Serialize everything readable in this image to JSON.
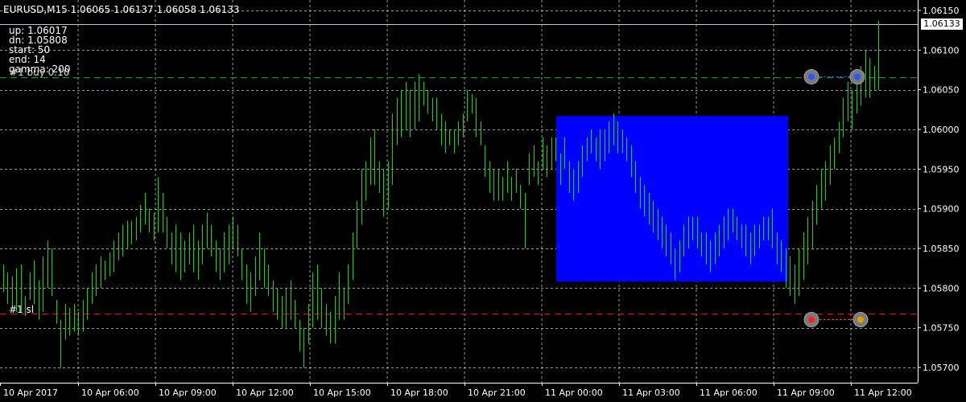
{
  "header": {
    "symbol_timeframe": "EURUSD,M15",
    "ohlc": "1.06065 1.06137 1.06058 1.06133"
  },
  "indicator": {
    "lines": [
      "up: 1.06017",
      "dn: 1.05808",
      "start: 50",
      "end: 14",
      "gamma: 200"
    ],
    "overlap_label": "#1 buy 0.10"
  },
  "trade_label": "#1 sl",
  "current_price_tag": "1.06133",
  "colors": {
    "background": "#000000",
    "grid": "#bfbfbf",
    "candle": "#00e000",
    "box": "#0000ff",
    "buy_line": "#00b000",
    "sl_line": "#ff0000",
    "bid_line": "#c8c8d4"
  },
  "chart_data": {
    "type": "candlestick",
    "symbol": "EURUSD",
    "timeframe": "M15",
    "ylim": [
      1.0568,
      1.0617
    ],
    "y_ticks": [
      "1.06150",
      "1.06100",
      "1.06050",
      "1.06000",
      "1.05950",
      "1.05900",
      "1.05850",
      "1.05800",
      "1.05750",
      "1.05700"
    ],
    "x_ticks": [
      "10 Apr 2017",
      "10 Apr 06:00",
      "10 Apr 09:00",
      "10 Apr 12:00",
      "10 Apr 15:00",
      "10 Apr 18:00",
      "10 Apr 21:00",
      "11 Apr 00:00",
      "11 Apr 03:00",
      "11 Apr 06:00",
      "11 Apr 09:00",
      "11 Apr 12:00"
    ],
    "box": {
      "up": 1.06017,
      "dn": 1.05808,
      "from": "11 Apr 00:00",
      "to": "11 Apr 09:00"
    },
    "levels": {
      "buy": 1.06066,
      "stop_loss": 1.05768,
      "bid": 1.06133
    },
    "bar_ranges": [
      [
        1.05795,
        1.0583
      ],
      [
        1.0578,
        1.0582
      ],
      [
        1.05775,
        1.05815
      ],
      [
        1.0577,
        1.05825
      ],
      [
        1.0577,
        1.0583
      ],
      [
        1.05765,
        1.0579
      ],
      [
        1.05785,
        1.0582
      ],
      [
        1.0578,
        1.05835
      ],
      [
        1.0576,
        1.0581
      ],
      [
        1.0577,
        1.0584
      ],
      [
        1.058,
        1.0586
      ],
      [
        1.0579,
        1.0585
      ],
      [
        1.05755,
        1.05785
      ],
      [
        1.057,
        1.0576
      ],
      [
        1.05735,
        1.0578
      ],
      [
        1.0574,
        1.05775
      ],
      [
        1.05745,
        1.0578
      ],
      [
        1.0574,
        1.0577
      ],
      [
        1.05745,
        1.05785
      ],
      [
        1.0576,
        1.058
      ],
      [
        1.0578,
        1.0582
      ],
      [
        1.0579,
        1.0583
      ],
      [
        1.058,
        1.0584
      ],
      [
        1.0581,
        1.05835
      ],
      [
        1.05815,
        1.05845
      ],
      [
        1.0582,
        1.0586
      ],
      [
        1.05835,
        1.0587
      ],
      [
        1.0584,
        1.0588
      ],
      [
        1.0585,
        1.05885
      ],
      [
        1.05855,
        1.05885
      ],
      [
        1.0586,
        1.0589
      ],
      [
        1.0587,
        1.05905
      ],
      [
        1.0588,
        1.0592
      ],
      [
        1.0587,
        1.059
      ],
      [
        1.0586,
        1.05895
      ],
      [
        1.0587,
        1.0594
      ],
      [
        1.0587,
        1.0592
      ],
      [
        1.0585,
        1.0589
      ],
      [
        1.0583,
        1.0587
      ],
      [
        1.0582,
        1.0588
      ],
      [
        1.0581,
        1.0587
      ],
      [
        1.0582,
        1.0586
      ],
      [
        1.0583,
        1.0587
      ],
      [
        1.0582,
        1.0588
      ],
      [
        1.0581,
        1.0586
      ],
      [
        1.0583,
        1.0588
      ],
      [
        1.0585,
        1.05895
      ],
      [
        1.0584,
        1.0588
      ],
      [
        1.0582,
        1.0586
      ],
      [
        1.0581,
        1.0585
      ],
      [
        1.0582,
        1.0587
      ],
      [
        1.0583,
        1.0588
      ],
      [
        1.0585,
        1.0589
      ],
      [
        1.0584,
        1.0588
      ],
      [
        1.0581,
        1.0585
      ],
      [
        1.0578,
        1.0583
      ],
      [
        1.0577,
        1.0582
      ],
      [
        1.0579,
        1.0584
      ],
      [
        1.0581,
        1.0587
      ],
      [
        1.058,
        1.0585
      ],
      [
        1.0579,
        1.0583
      ],
      [
        1.0577,
        1.0581
      ],
      [
        1.0576,
        1.058
      ],
      [
        1.0575,
        1.0579
      ],
      [
        1.0575,
        1.058
      ],
      [
        1.0576,
        1.0581
      ],
      [
        1.0575,
        1.05785
      ],
      [
        1.0572,
        1.0576
      ],
      [
        1.057,
        1.0575
      ],
      [
        1.0573,
        1.0578
      ],
      [
        1.0575,
        1.0582
      ],
      [
        1.0576,
        1.0583
      ],
      [
        1.0575,
        1.058
      ],
      [
        1.0574,
        1.0578
      ],
      [
        1.0573,
        1.0577
      ],
      [
        1.0573,
        1.0579
      ],
      [
        1.0576,
        1.0582
      ],
      [
        1.0576,
        1.058
      ],
      [
        1.0578,
        1.0583
      ],
      [
        1.0581,
        1.0587
      ],
      [
        1.0585,
        1.0591
      ],
      [
        1.0588,
        1.0595
      ],
      [
        1.0591,
        1.0596
      ],
      [
        1.0593,
        1.0599
      ],
      [
        1.0593,
        1.06
      ],
      [
        1.0592,
        1.0596
      ],
      [
        1.0589,
        1.0595
      ],
      [
        1.059,
        1.0596
      ],
      [
        1.0593,
        1.0602
      ],
      [
        1.0598,
        1.0604
      ],
      [
        1.0599,
        1.0605
      ],
      [
        1.06,
        1.0606
      ],
      [
        1.0599,
        1.0605
      ],
      [
        1.06,
        1.0606
      ],
      [
        1.0601,
        1.0607
      ],
      [
        1.0603,
        1.0606
      ],
      [
        1.0602,
        1.0605
      ],
      [
        1.0601,
        1.0604
      ],
      [
        1.06,
        1.0604
      ],
      [
        1.0598,
        1.0602
      ],
      [
        1.0597,
        1.0601
      ],
      [
        1.0598,
        1.06
      ],
      [
        1.0597,
        1.06
      ],
      [
        1.0598,
        1.0601
      ],
      [
        1.0599,
        1.0602
      ],
      [
        1.0601,
        1.0605
      ],
      [
        1.0602,
        1.06045
      ],
      [
        1.0599,
        1.0604
      ],
      [
        1.0598,
        1.0601
      ],
      [
        1.0594,
        1.0598
      ],
      [
        1.0592,
        1.0596
      ],
      [
        1.0591,
        1.0595
      ],
      [
        1.0591,
        1.0595
      ],
      [
        1.0591,
        1.0594
      ],
      [
        1.0592,
        1.0596
      ],
      [
        1.0591,
        1.0594
      ],
      [
        1.0592,
        1.0595
      ],
      [
        1.059,
        1.0593
      ],
      [
        1.0585,
        1.0592
      ],
      [
        1.0593,
        1.0597
      ],
      [
        1.0594,
        1.0598
      ],
      [
        1.0593,
        1.0596
      ],
      [
        1.0595,
        1.0599
      ],
      [
        1.0594,
        1.0598
      ],
      [
        1.0595,
        1.0599
      ],
      [
        1.0596,
        1.0599
      ],
      [
        1.0593,
        1.0597
      ],
      [
        1.0595,
        1.0599
      ],
      [
        1.0592,
        1.0596
      ],
      [
        1.0591,
        1.0595
      ],
      [
        1.0592,
        1.0596
      ],
      [
        1.0594,
        1.0598
      ],
      [
        1.0596,
        1.0599
      ],
      [
        1.0597,
        1.06
      ],
      [
        1.0596,
        1.0599
      ],
      [
        1.0595,
        1.06
      ],
      [
        1.0596,
        1.06
      ],
      [
        1.0597,
        1.0601
      ],
      [
        1.0598,
        1.0602
      ],
      [
        1.0597,
        1.0601
      ],
      [
        1.0597,
        1.06
      ],
      [
        1.0596,
        1.0599
      ],
      [
        1.0594,
        1.0598
      ],
      [
        1.0592,
        1.0596
      ],
      [
        1.059,
        1.0594
      ],
      [
        1.0589,
        1.0593
      ],
      [
        1.0588,
        1.0592
      ],
      [
        1.0587,
        1.0591
      ],
      [
        1.0586,
        1.059
      ],
      [
        1.0585,
        1.0589
      ],
      [
        1.0584,
        1.0588
      ],
      [
        1.0583,
        1.0587
      ],
      [
        1.0581,
        1.0585
      ],
      [
        1.0582,
        1.0586
      ],
      [
        1.0584,
        1.0588
      ],
      [
        1.0585,
        1.0589
      ],
      [
        1.0586,
        1.0589
      ],
      [
        1.0585,
        1.0589
      ],
      [
        1.0584,
        1.0587
      ],
      [
        1.0583,
        1.0587
      ],
      [
        1.0582,
        1.0586
      ],
      [
        1.0583,
        1.0587
      ],
      [
        1.0584,
        1.0588
      ],
      [
        1.0585,
        1.0589
      ],
      [
        1.0586,
        1.059
      ],
      [
        1.0587,
        1.059
      ],
      [
        1.0586,
        1.0589
      ],
      [
        1.0585,
        1.0588
      ],
      [
        1.0584,
        1.0588
      ],
      [
        1.0583,
        1.0587
      ],
      [
        1.0584,
        1.0588
      ],
      [
        1.0585,
        1.0588
      ],
      [
        1.0586,
        1.0589
      ],
      [
        1.0586,
        1.0589
      ],
      [
        1.0585,
        1.059
      ],
      [
        1.0583,
        1.0587
      ],
      [
        1.0582,
        1.0586
      ],
      [
        1.058,
        1.0585
      ],
      [
        1.0579,
        1.0584
      ],
      [
        1.0578,
        1.0583
      ],
      [
        1.0579,
        1.0585
      ],
      [
        1.0581,
        1.0587
      ],
      [
        1.0583,
        1.0589
      ],
      [
        1.0585,
        1.0591
      ],
      [
        1.0588,
        1.0593
      ],
      [
        1.059,
        1.0595
      ],
      [
        1.0591,
        1.0596
      ],
      [
        1.0593,
        1.0598
      ],
      [
        1.0595,
        1.0599
      ],
      [
        1.0597,
        1.0601
      ],
      [
        1.0599,
        1.0604
      ],
      [
        1.0601,
        1.0606
      ],
      [
        1.06,
        1.0605
      ],
      [
        1.0602,
        1.0607
      ],
      [
        1.0603,
        1.0608
      ],
      [
        1.0604,
        1.061
      ],
      [
        1.0604,
        1.0609
      ],
      [
        1.0605,
        1.0608
      ],
      [
        1.0605,
        1.06137
      ]
    ]
  }
}
